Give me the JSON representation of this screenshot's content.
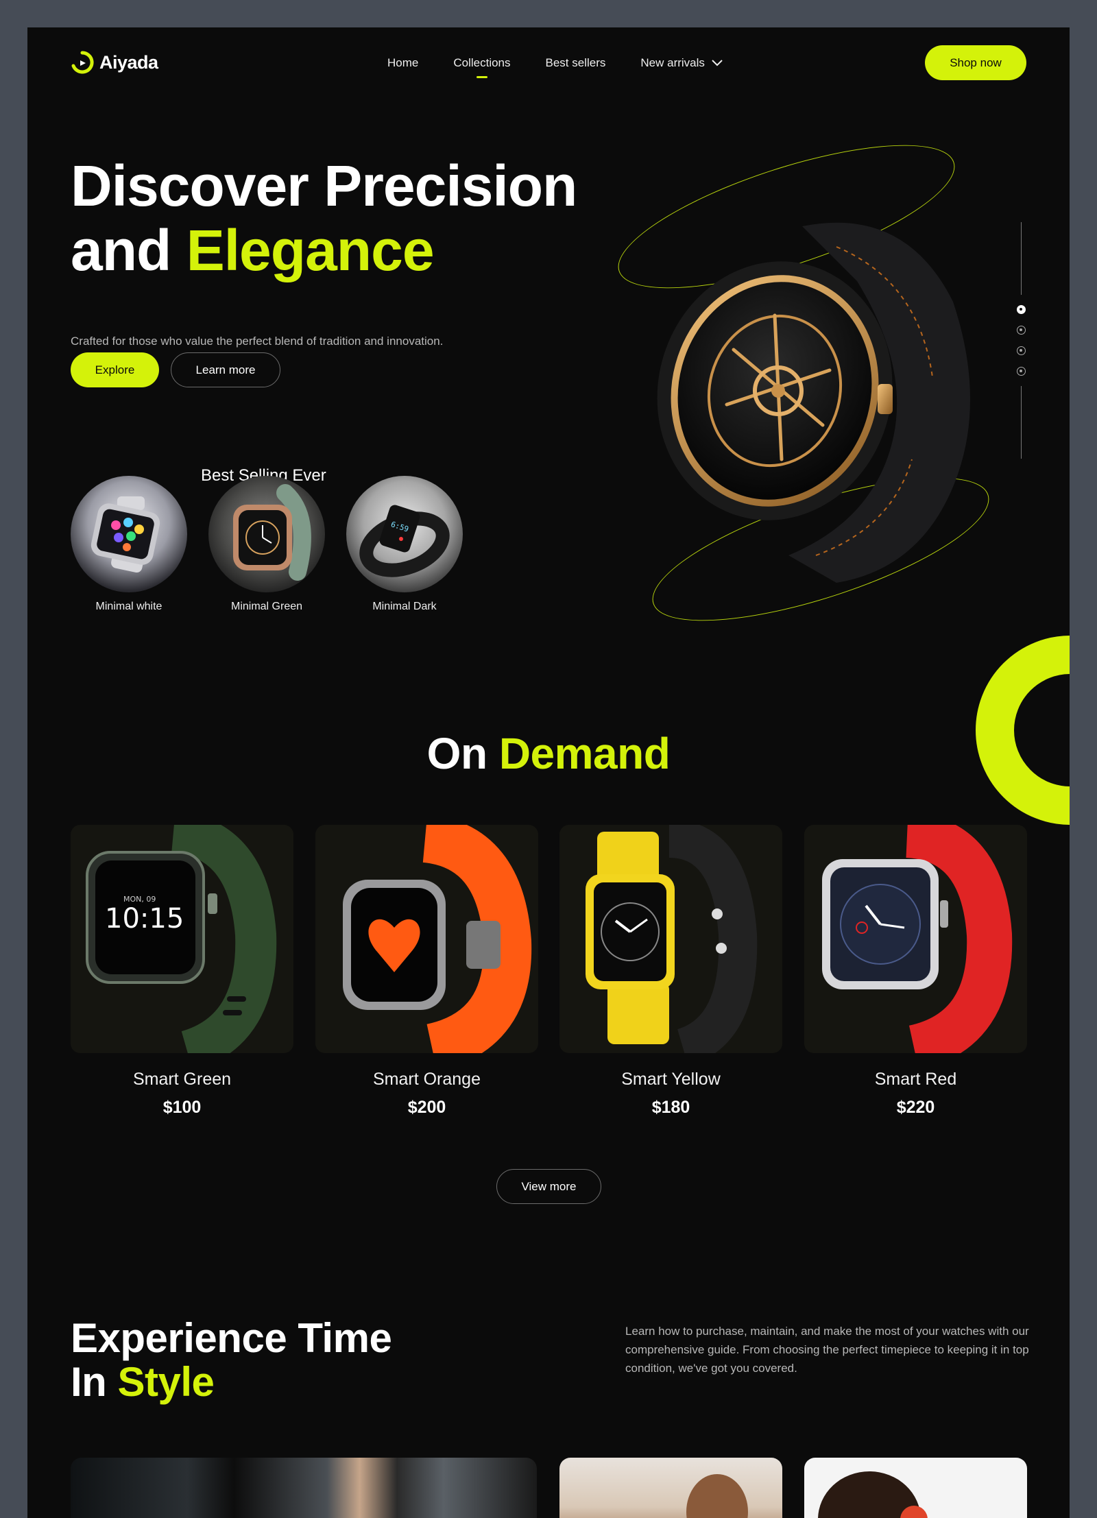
{
  "brand": {
    "name": "Aiyada",
    "accent": "#d4f20a"
  },
  "nav": {
    "items": [
      {
        "label": "Home"
      },
      {
        "label": "Collections"
      },
      {
        "label": "Best sellers"
      },
      {
        "label": "New arrivals"
      }
    ],
    "active": "Collections",
    "cta": "Shop now"
  },
  "hero": {
    "title_line1": "Discover Precision",
    "title_and": "and",
    "title_highlight": "Elegance",
    "subtitle": "Crafted for those who value the perfect blend of tradition and innovation.",
    "explore": "Explore",
    "learn_more": "Learn more",
    "best_heading": "Best Selling Ever",
    "best": [
      {
        "label": "Minimal white"
      },
      {
        "label": "Minimal Green"
      },
      {
        "label": "Minimal Dark"
      }
    ],
    "slider_active": 1,
    "slider_count": 4
  },
  "on_demand": {
    "title_plain": "On",
    "title_highlight": "Demand",
    "products": [
      {
        "name": "Smart Green",
        "price": "$100",
        "screen": "10:15",
        "date": "MON, 09"
      },
      {
        "name": "Smart Orange",
        "price": "$200"
      },
      {
        "name": "Smart Yellow",
        "price": "$180"
      },
      {
        "name": "Smart Red",
        "price": "$220"
      }
    ],
    "view_more": "View more"
  },
  "experience": {
    "title_line1": "Experience Time",
    "title_in": "In",
    "title_highlight": "Style",
    "text": "Learn how to purchase, maintain, and make the most of your watches with our comprehensive guide. From choosing the perfect timepiece to keeping it in top condition, we've got you covered."
  }
}
